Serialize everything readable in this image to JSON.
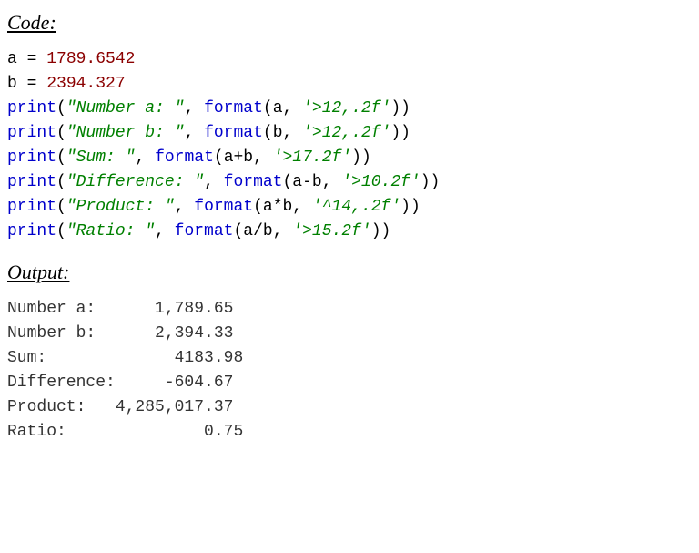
{
  "headings": {
    "code": "Code:",
    "output": "Output:"
  },
  "code": {
    "line1": {
      "var": "a",
      "assign": " = ",
      "num": "1789.6542"
    },
    "line2": {
      "var": "b",
      "assign": " = ",
      "num": "2394.327"
    },
    "line3": {
      "fn1": "print",
      "lp1": "(",
      "str1": "\"Number a: \"",
      "comma1": ", ",
      "fn2": "format",
      "lp2": "(",
      "arg": "a",
      "comma2": ", ",
      "str2": "'>12,.2f'",
      "rp2": ")",
      "rp1": ")"
    },
    "line4": {
      "fn1": "print",
      "lp1": "(",
      "str1": "\"Number b: \"",
      "comma1": ", ",
      "fn2": "format",
      "lp2": "(",
      "arg": "b",
      "comma2": ", ",
      "str2": "'>12,.2f'",
      "rp2": ")",
      "rp1": ")"
    },
    "line5": {
      "fn1": "print",
      "lp1": "(",
      "str1": "\"Sum: \"",
      "comma1": ", ",
      "fn2": "format",
      "lp2": "(",
      "arg": "a+b",
      "comma2": ", ",
      "str2": "'>17.2f'",
      "rp2": ")",
      "rp1": ")"
    },
    "line6": {
      "fn1": "print",
      "lp1": "(",
      "str1": "\"Difference: \"",
      "comma1": ", ",
      "fn2": "format",
      "lp2": "(",
      "arg": "a-b",
      "comma2": ", ",
      "str2": "'>10.2f'",
      "rp2": ")",
      "rp1": ")"
    },
    "line7": {
      "fn1": "print",
      "lp1": "(",
      "str1": "\"Product: \"",
      "comma1": ", ",
      "fn2": "format",
      "lp2": "(",
      "arg": "a*b",
      "comma2": ", ",
      "str2": "'^14,.2f'",
      "rp2": ")",
      "rp1": ")"
    },
    "line8": {
      "fn1": "print",
      "lp1": "(",
      "str1": "\"Ratio: \"",
      "comma1": ", ",
      "fn2": "format",
      "lp2": "(",
      "arg": "a/b",
      "comma2": ", ",
      "str2": "'>15.2f'",
      "rp2": ")",
      "rp1": ")"
    }
  },
  "output": {
    "l1": "Number a:      1,789.65",
    "l2": "Number b:      2,394.33",
    "l3": "Sum:             4183.98",
    "l4": "Difference:     -604.67",
    "l5": "Product:   4,285,017.37",
    "l6": "Ratio:              0.75"
  }
}
